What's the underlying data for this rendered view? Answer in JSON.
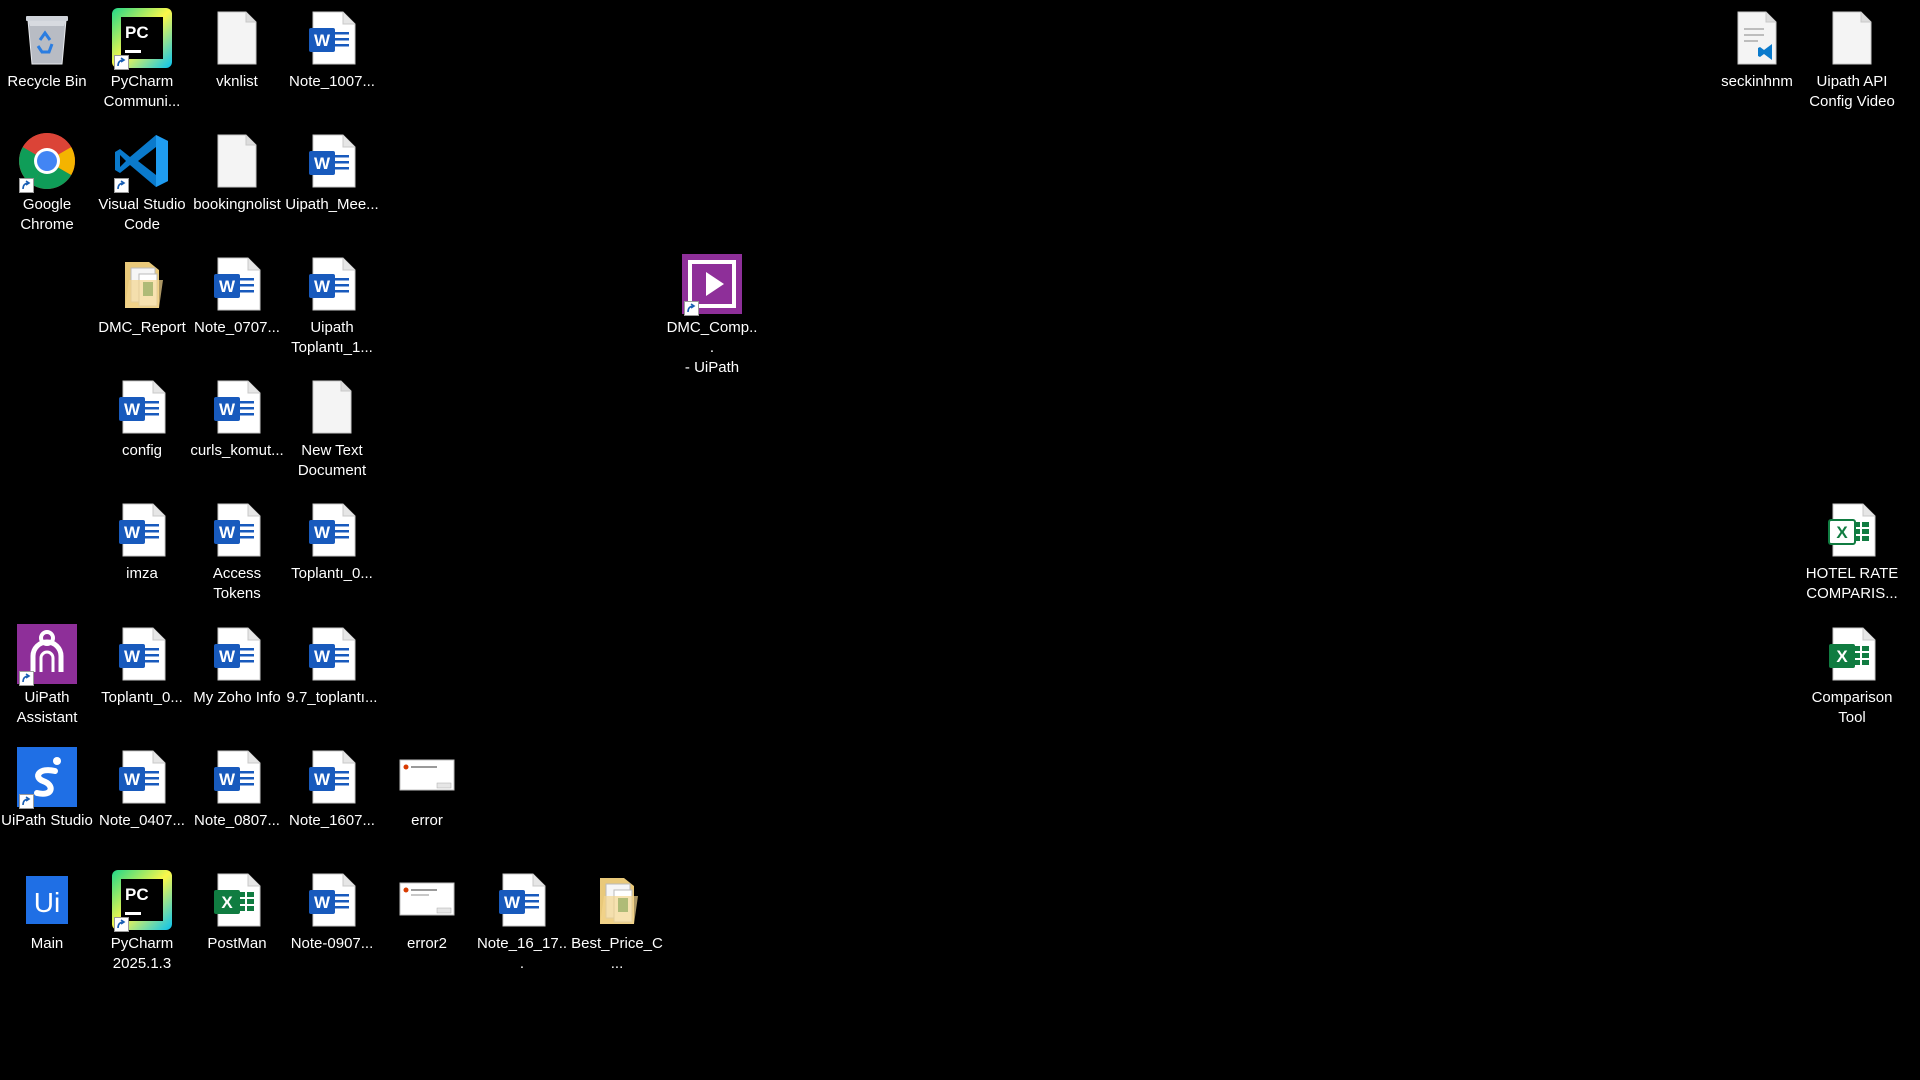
{
  "colors": {
    "desktop_background": "#000000",
    "label_text": "#ffffff",
    "word_blue": "#185abd",
    "excel_green": "#107c41",
    "uipath_purple": "#7b2d8e",
    "uipath_blue": "#0067df"
  },
  "desktop": {
    "icons": [
      {
        "label": "Recycle Bin",
        "icon": "recycle-bin-icon"
      },
      {
        "label": "PyCharm\nCommuni...",
        "icon": "pycharm-icon"
      },
      {
        "label": "vknlist",
        "icon": "text-file-icon"
      },
      {
        "label": "Note_1007...",
        "icon": "word-document-icon"
      },
      {
        "label": "Google\nChrome",
        "icon": "chrome-icon"
      },
      {
        "label": "Visual Studio\nCode",
        "icon": "vscode-icon"
      },
      {
        "label": "bookingnolist",
        "icon": "text-file-icon"
      },
      {
        "label": "Uipath_Mee...",
        "icon": "word-document-icon"
      },
      {
        "label": "DMC_Report",
        "icon": "folder-icon"
      },
      {
        "label": "Note_0707...",
        "icon": "word-document-icon"
      },
      {
        "label": "Uipath\nToplantı_1...",
        "icon": "word-document-icon"
      },
      {
        "label": "config",
        "icon": "word-document-icon"
      },
      {
        "label": "curls_komut...",
        "icon": "word-document-icon"
      },
      {
        "label": "New Text\nDocument",
        "icon": "text-file-icon"
      },
      {
        "label": "imza",
        "icon": "word-document-icon"
      },
      {
        "label": "Access\nTokens",
        "icon": "word-document-icon"
      },
      {
        "label": "Toplantı_0...",
        "icon": "word-document-icon"
      },
      {
        "label": "UiPath\nAssistant",
        "icon": "uipath-assistant-icon"
      },
      {
        "label": "Toplantı_0...",
        "icon": "word-document-icon"
      },
      {
        "label": "My Zoho Info",
        "icon": "word-document-icon"
      },
      {
        "label": "9.7_toplantı...",
        "icon": "word-document-icon"
      },
      {
        "label": "UiPath Studio",
        "icon": "uipath-studio-icon"
      },
      {
        "label": "Note_0407...",
        "icon": "word-document-icon"
      },
      {
        "label": "Note_0807...",
        "icon": "word-document-icon"
      },
      {
        "label": "Note_1607...",
        "icon": "word-document-icon"
      },
      {
        "label": "error",
        "icon": "screenshot-image-icon"
      },
      {
        "label": "Main",
        "icon": "uipath-main-icon"
      },
      {
        "label": "PyCharm\n2025.1.3",
        "icon": "pycharm-icon"
      },
      {
        "label": "PostMan",
        "icon": "excel-document-icon"
      },
      {
        "label": "Note-0907...",
        "icon": "word-document-icon"
      },
      {
        "label": "error2",
        "icon": "screenshot-image-icon"
      },
      {
        "label": "Note_16_17...",
        "icon": "word-document-icon"
      },
      {
        "label": "Best_Price_C...",
        "icon": "folder-icon"
      },
      {
        "label": "DMC_Comp...\n- UiPath",
        "icon": "uipath-video-icon"
      },
      {
        "label": "seckinhnm",
        "icon": "vscode-file-icon"
      },
      {
        "label": "Uipath API\nConfig Video",
        "icon": "text-file-icon"
      },
      {
        "label": "HOTEL RATE\nCOMPARIS...",
        "icon": "excel-document-icon"
      },
      {
        "label": "Comparison\nTool",
        "icon": "excel-document-icon"
      }
    ]
  }
}
